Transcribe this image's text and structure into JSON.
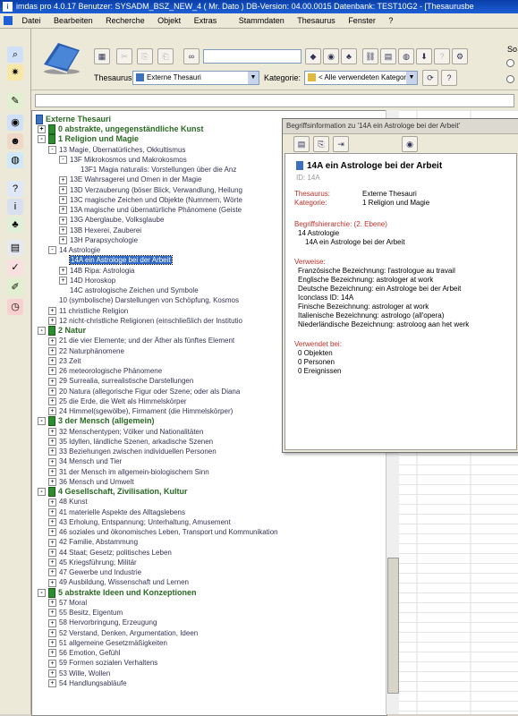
{
  "window": {
    "title": "imdas pro 4.0.17  Benutzer: SYSADM_BSZ_NEW_4 ( Mr. Dato )   DB-Version: 04.00.0015   Datenbank: TEST10G2 - [Thesaurusbe"
  },
  "menu": [
    "Datei",
    "Bearbeiten",
    "Recherche",
    "Objekt",
    "Extras",
    "Stammdaten",
    "Thesaurus",
    "Fenster",
    "?"
  ],
  "toolbar": {
    "thesaurus_label": "Thesaurus:",
    "thesaurus_value": "Externe Thesauri",
    "kategorie_label": "Kategorie:",
    "kategorie_value": "< Alle verwendeten Kategorien >",
    "right_label": "So"
  },
  "tree": {
    "root": "Externe Thesauri",
    "rows": [
      {
        "label": "0 abstrakte, ungegenständliche Kunst",
        "bold": true
      },
      {
        "label": "1 Religion und Magie",
        "bold": true
      },
      {
        "label": "13 Magie, Übernatürliches, Okkultismus",
        "bold": false
      },
      {
        "label": "13F Mikrokosmos und Makrokosmos",
        "bold": false
      },
      {
        "label": "13F1 Magia naturalis: Vorstellungen über die Anz",
        "bold": false
      },
      {
        "label": "13E Wahrsagerei und Omen in der Magie",
        "bold": false
      },
      {
        "label": "13D Verzauberung (böser Blick, Verwandlung, Heilung",
        "bold": false
      },
      {
        "label": "13C magische Zeichen und Objekte (Nummern, Wörte",
        "bold": false
      },
      {
        "label": "13A magische und übernatürliche Phänomene (Geiste",
        "bold": false
      },
      {
        "label": "13G Aberglaube, Volksglaube",
        "bold": false
      },
      {
        "label": "13B Hexerei, Zauberei",
        "bold": false
      },
      {
        "label": "13H Parapsychologie",
        "bold": false
      },
      {
        "label": "14 Astrologie",
        "bold": false
      },
      {
        "label": "14A ein Astrologe bei der Arbeit",
        "bold": false,
        "selected": true
      },
      {
        "label": "14B Ripa: Astrologia",
        "bold": false
      },
      {
        "label": "14D Horoskop",
        "bold": false
      },
      {
        "label": "14C astrologische Zeichen und Symbole",
        "bold": false
      },
      {
        "label": "10 (symbolische) Darstellungen von Schöpfung, Kosmos",
        "bold": false
      },
      {
        "label": "11 christliche Religion",
        "bold": false
      },
      {
        "label": "12 nicht-christliche Religionen (einschließlich der Institutio",
        "bold": false
      },
      {
        "label": "2 Natur",
        "bold": true
      },
      {
        "label": "21 die vier Elemente; und der Äther als fünftes Element",
        "bold": false
      },
      {
        "label": "22 Naturphänomene",
        "bold": false
      },
      {
        "label": "23 Zeit",
        "bold": false
      },
      {
        "label": "26 meteorologische Phänomene",
        "bold": false
      },
      {
        "label": "29 Surrealia, surrealistische Darstellungen",
        "bold": false
      },
      {
        "label": "20 Natura (allegorische Figur oder Szene; oder als Diana",
        "bold": false
      },
      {
        "label": "25 die Erde, die Welt als Himmelskörper",
        "bold": false
      },
      {
        "label": "24 Himmel(sgewölbe), Firmament (die Himmelskörper)",
        "bold": false
      },
      {
        "label": "3 der Mensch (allgemein)",
        "bold": true
      },
      {
        "label": "32 Menschentypen; Völker und Nationalitäten",
        "bold": false
      },
      {
        "label": "35 Idyllen, ländliche Szenen, arkadische Szenen",
        "bold": false
      },
      {
        "label": "33 Beziehungen zwischen individuellen Personen",
        "bold": false
      },
      {
        "label": "34 Mensch und Tier",
        "bold": false
      },
      {
        "label": "31 der Mensch im allgemein-biologischem Sinn",
        "bold": false
      },
      {
        "label": "36 Mensch und Umwelt",
        "bold": false
      },
      {
        "label": "4 Gesellschaft, Zivilisation, Kultur",
        "bold": true
      },
      {
        "label": "48 Kunst",
        "bold": false
      },
      {
        "label": "41 materielle Aspekte des Alltagslebens",
        "bold": false
      },
      {
        "label": "43 Erholung, Entspannung; Unterhaltung, Amusement",
        "bold": false
      },
      {
        "label": "46 soziales und ökonomisches Leben, Transport und Kommunikation",
        "bold": false
      },
      {
        "label": "42 Familie, Abstammung",
        "bold": false
      },
      {
        "label": "44 Staat; Gesetz; politisches Leben",
        "bold": false
      },
      {
        "label": "45 Kriegsführung; Militär",
        "bold": false
      },
      {
        "label": "47 Gewerbe und Industrie",
        "bold": false
      },
      {
        "label": "49 Ausbildung, Wissenschaft und Lernen",
        "bold": false
      },
      {
        "label": "5 abstrakte Ideen und Konzeptionen",
        "bold": true
      },
      {
        "label": "57 Moral",
        "bold": false
      },
      {
        "label": "55 Besitz, Eigentum",
        "bold": false
      },
      {
        "label": "58 Hervorbringung, Erzeugung",
        "bold": false
      },
      {
        "label": "52 Verstand, Denken, Argumentation, Ideen",
        "bold": false
      },
      {
        "label": "51 allgemeine Gesetzmäßigkeiten",
        "bold": false
      },
      {
        "label": "56 Emotion, Gefühl",
        "bold": false
      },
      {
        "label": "59 Formen sozialen Verhaltens",
        "bold": false
      },
      {
        "label": "53 Wille, Wollen",
        "bold": false
      },
      {
        "label": "54 Handlungsabläufe",
        "bold": false
      }
    ]
  },
  "popup": {
    "title": "Begriffsinformation zu '14A ein Astrologe bei der Arbeit'",
    "heading": "14A ein Astrologe bei der Arbeit",
    "id_text": "ID: 14A",
    "thesaurus_label": "Thesaurus:",
    "thesaurus_value": "Externe Thesauri",
    "kategorie_label": "Kategorie:",
    "kategorie_value": "1 Religion und Magie",
    "hier_label": "Begriffshierarchie: (2. Ebene)",
    "hier_1": "14 Astrologie",
    "hier_2": "14A ein Astrologe bei der Arbeit",
    "verweise_label": "Verweise:",
    "verweise": [
      "Französische Bezeichnung: l'astrologue au travail",
      "Englische Bezeichnung: astrologer at work",
      "Deutsche Bezeichnung: ein Astrologe bei der Arbeit",
      "Iconclass ID: 14A",
      "Finische Bezeichnung: astrologer at work",
      "Italienische Bezeichnung: astrologo (all'opera)",
      "Niederländische Bezeichnung: astroloog aan het werk"
    ],
    "verwendet_label": "Verwendet bei:",
    "verwendet": [
      "0 Objekten",
      "0 Personen",
      "0 Ereignissen"
    ]
  },
  "colors": {
    "title_bar": "#1d5fd6",
    "tree_bold": "#2a6a24",
    "selection": "#3169c6",
    "info_label": "#c0302a"
  }
}
